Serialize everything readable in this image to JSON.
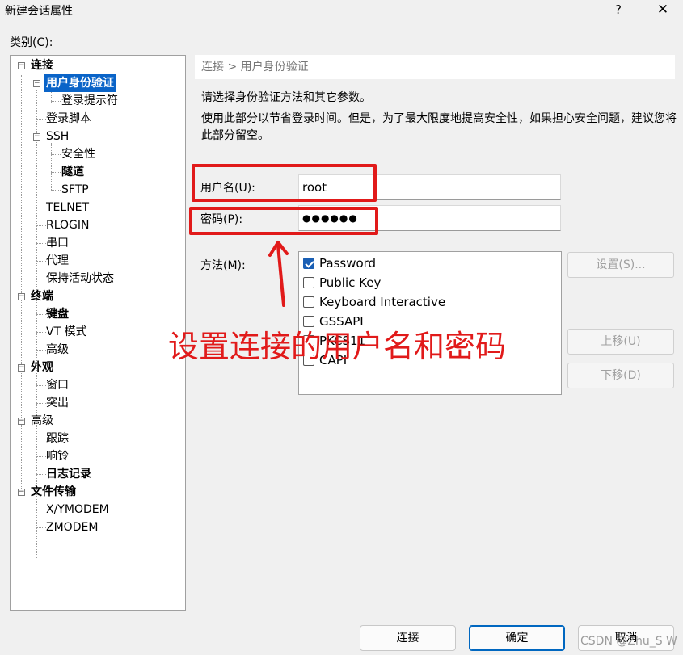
{
  "window": {
    "title": "新建会话属性",
    "help_symbol": "?",
    "close_symbol": "✕"
  },
  "category_label": "类别(C):",
  "tree": {
    "items": [
      {
        "label": "连接"
      },
      {
        "label": "用户身份验证"
      },
      {
        "label": "登录提示符"
      },
      {
        "label": "登录脚本"
      },
      {
        "label": "SSH"
      },
      {
        "label": "安全性"
      },
      {
        "label": "隧道"
      },
      {
        "label": "SFTP"
      },
      {
        "label": "TELNET"
      },
      {
        "label": "RLOGIN"
      },
      {
        "label": "串口"
      },
      {
        "label": "代理"
      },
      {
        "label": "保持活动状态"
      },
      {
        "label": "终端"
      },
      {
        "label": "键盘"
      },
      {
        "label": "VT 模式"
      },
      {
        "label": "高级"
      },
      {
        "label": "外观"
      },
      {
        "label": "窗口"
      },
      {
        "label": "突出"
      },
      {
        "label": "高级"
      },
      {
        "label": "跟踪"
      },
      {
        "label": "响铃"
      },
      {
        "label": "日志记录"
      },
      {
        "label": "文件传输"
      },
      {
        "label": "X/YMODEM"
      },
      {
        "label": "ZMODEM"
      }
    ],
    "expander_symbol": "−"
  },
  "breadcrumb": "连接 > 用户身份验证",
  "description_1": "请选择身份验证方法和其它参数。",
  "description_2": "使用此部分以节省登录时间。但是，为了最大限度地提高安全性，如果担心安全问题，建议您将此部分留空。",
  "form": {
    "username_label": "用户名(U):",
    "username_value": "root",
    "password_label": "密码(P):",
    "password_value": "●●●●●●",
    "method_label": "方法(M):"
  },
  "methods": [
    {
      "label": "Password",
      "checked": true
    },
    {
      "label": "Public Key",
      "checked": false
    },
    {
      "label": "Keyboard Interactive",
      "checked": false
    },
    {
      "label": "GSSAPI",
      "checked": false
    },
    {
      "label": "PKCS11",
      "checked": false
    },
    {
      "label": "CAPI",
      "checked": false
    }
  ],
  "side_buttons": {
    "settings": "设置(S)...",
    "move_up": "上移(U)",
    "move_down": "下移(D)"
  },
  "bottom_buttons": {
    "connect": "连接",
    "ok": "确定",
    "cancel": "取消"
  },
  "annotation_text": "设置连接的用户名和密码",
  "watermark": "CSDN @Zhu_S W",
  "colors": {
    "selection": "#0a64c8",
    "annotation_red": "#e11a1a",
    "checkbox_blue": "#1a5fb4"
  }
}
